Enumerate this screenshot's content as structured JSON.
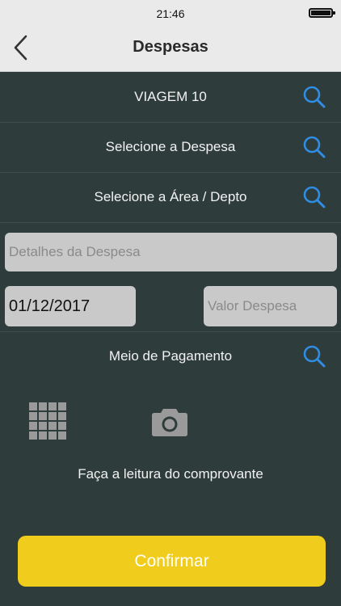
{
  "status_bar": {
    "time": "21:46"
  },
  "nav": {
    "title": "Despesas"
  },
  "rows": {
    "trip": "VIAGEM 10",
    "expense": "Selecione a Despesa",
    "area": "Selecione a Área / Depto",
    "payment": "Meio de Pagamento"
  },
  "fields": {
    "details_placeholder": "Detalhes da Despesa",
    "details_value": "",
    "date_value": "01/12/2017",
    "amount_placeholder": "Valor Despesa",
    "amount_value": ""
  },
  "receipt": {
    "hint": "Faça a leitura do comprovante"
  },
  "actions": {
    "confirm_label": "Confirmar"
  },
  "colors": {
    "background": "#2f3c3c",
    "accent_blue": "#2f8de4",
    "confirm_yellow": "#f0cc1c",
    "field_gray": "#c9c9c9"
  }
}
